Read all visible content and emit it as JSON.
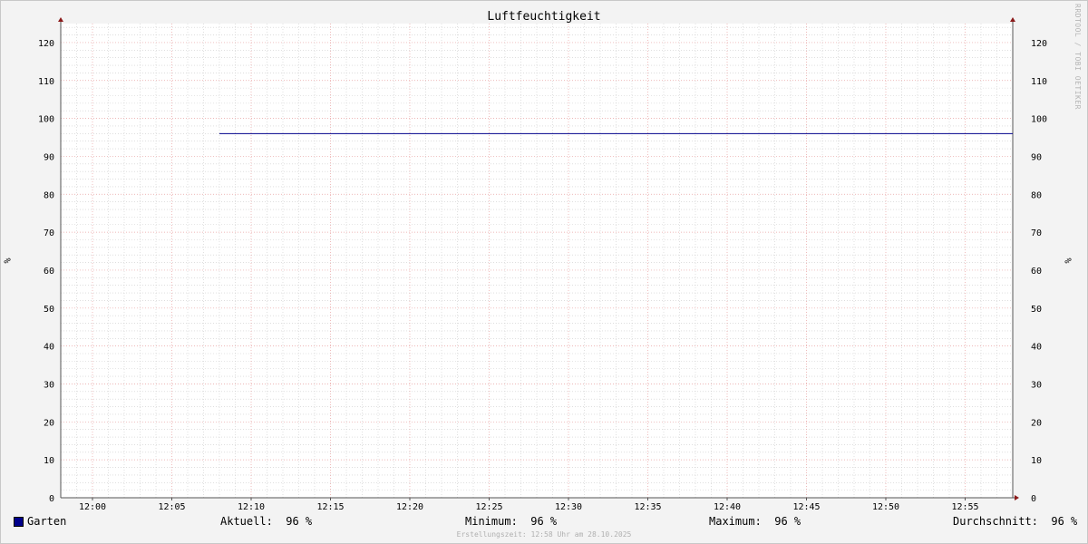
{
  "title": "Luftfeuchtigkeit",
  "watermark": "RRDTOOL / TOBI OETIKER",
  "colors": {
    "background": "#f3f3f3",
    "plot_background": "#ffffff",
    "major_grid": "#e8a0a0",
    "minor_grid": "#cccccc",
    "axis": "#555555",
    "arrow": "#8b1a1a",
    "series": "#00008b"
  },
  "legend": {
    "series_name": "Garten",
    "current_label": "Aktuell:",
    "current_value": "96 %",
    "minimum_label": "Minimum:",
    "minimum_value": "96 %",
    "maximum_label": "Maximum:",
    "maximum_value": "96 %",
    "average_label": "Durchschnitt:",
    "average_value": "96 %"
  },
  "footer": "Erstellungszeit: 12:58 Uhr am 28.10.2025",
  "chart_data": {
    "type": "line",
    "title": "Luftfeuchtigkeit",
    "ylabel": "%",
    "ylabel_right": "%",
    "xlabel": "",
    "x_range": [
      "11:58",
      "12:58"
    ],
    "ylim": [
      0,
      125
    ],
    "y_ticks": [
      0,
      10,
      20,
      30,
      40,
      50,
      60,
      70,
      80,
      90,
      100,
      110,
      120
    ],
    "x_ticks": [
      "12:00",
      "12:05",
      "12:10",
      "12:15",
      "12:20",
      "12:25",
      "12:30",
      "12:35",
      "12:40",
      "12:45",
      "12:50",
      "12:55"
    ],
    "grid": true,
    "series": [
      {
        "name": "Garten",
        "color": "#00008b",
        "points": [
          {
            "x": "12:08",
            "y": 96
          },
          {
            "x": "12:58",
            "y": 96
          }
        ]
      }
    ]
  }
}
